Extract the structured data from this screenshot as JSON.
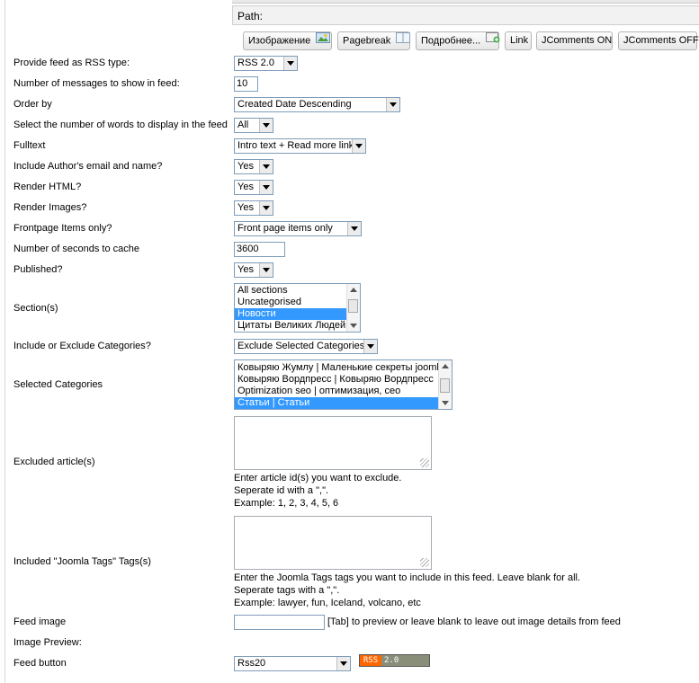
{
  "path": {
    "label": "Path:"
  },
  "editor_buttons": [
    {
      "label": "Изображение",
      "icon": "image-icon"
    },
    {
      "label": "Pagebreak",
      "icon": "pagebreak-icon"
    },
    {
      "label": "Подробнее...",
      "icon": "readmore-icon"
    },
    {
      "label": "Link"
    },
    {
      "label": "JComments ON"
    },
    {
      "label": "JComments OFF"
    }
  ],
  "form": {
    "rss_type": {
      "label": "Provide feed as RSS type:",
      "value": "RSS 2.0"
    },
    "num_messages": {
      "label": "Number of messages to show in feed:",
      "value": "10"
    },
    "order_by": {
      "label": "Order by",
      "value": "Created Date Descending"
    },
    "num_words": {
      "label": "Select the number of words to display in the feed",
      "value": "All"
    },
    "fulltext": {
      "label": "Fulltext",
      "value": "Intro text + Read more link"
    },
    "author": {
      "label": "Include Author's email and name?",
      "value": "Yes"
    },
    "render_html": {
      "label": "Render HTML?",
      "value": "Yes"
    },
    "render_images": {
      "label": "Render Images?",
      "value": "Yes"
    },
    "frontpage": {
      "label": "Frontpage Items only?",
      "value": "Front page items only"
    },
    "cache": {
      "label": "Number of seconds to cache",
      "value": "3600"
    },
    "published": {
      "label": "Published?",
      "value": "Yes"
    },
    "sections": {
      "label": "Section(s)",
      "options": [
        "All sections",
        "Uncategorised",
        "Новости",
        "Цитаты Великих Людей"
      ],
      "selected_index": 2
    },
    "incl_excl": {
      "label": "Include or Exclude Categories?",
      "value": "Exclude Selected Categories"
    },
    "categories": {
      "label": "Selected Categories",
      "options": [
        "Ковыряю Жумлу | Маленькие секреты joomla",
        "Ковыряю Вордпресс | Ковыряю Вордпресс",
        "Optimization seo | оптимизация, сео",
        "Статьи | Статьи"
      ],
      "selected_index": 3
    },
    "excluded": {
      "label": "Excluded article(s)",
      "help": [
        "Enter article id(s) you want to exclude.",
        "Seperate id with a \",\".",
        "Example: 1, 2, 3, 4, 5, 6"
      ]
    },
    "tags": {
      "label": "Included \"Joomla Tags\" Tags(s)",
      "help": [
        "Enter the Joomla Tags tags you want to include in this feed. Leave blank for all.",
        "Seperate tags with a \",\".",
        "Example: lawyer, fun, Iceland, volcano, etc"
      ]
    },
    "feed_image": {
      "label": "Feed image",
      "value": "",
      "help": "[Tab] to preview or leave blank to leave out image details from feed"
    },
    "image_preview": {
      "label": "Image Preview:"
    },
    "feed_button": {
      "label": "Feed button",
      "value": "Rss20",
      "badge_left": "RSS",
      "badge_right": "2.0"
    }
  }
}
